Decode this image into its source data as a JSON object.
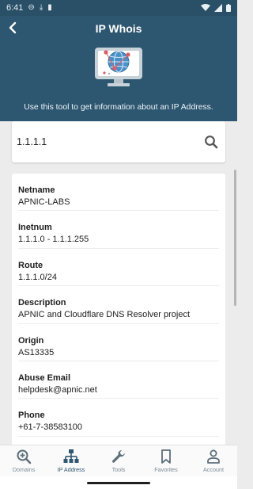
{
  "status_bar": {
    "time": "6:41"
  },
  "header": {
    "title": "IP Whois",
    "subtitle": "Use this tool to get information about an IP Address."
  },
  "search": {
    "value": "1.1.1.1",
    "placeholder": ""
  },
  "results": [
    {
      "label": "Netname",
      "value": "APNIC-LABS"
    },
    {
      "label": "Inetnum",
      "value": "1.1.1.0 - 1.1.1.255"
    },
    {
      "label": "Route",
      "value": "1.1.1.0/24"
    },
    {
      "label": "Description",
      "value": "APNIC and Cloudflare DNS Resolver project"
    },
    {
      "label": "Origin",
      "value": "AS13335"
    },
    {
      "label": "Abuse Email",
      "value": "helpdesk@apnic.net"
    },
    {
      "label": "Phone",
      "value": "+61-7-38583100"
    }
  ],
  "bottom_nav": [
    {
      "label": "Domains",
      "icon": "magnify-plus-icon"
    },
    {
      "label": "IP Address",
      "icon": "network-icon",
      "active": true
    },
    {
      "label": "Tools",
      "icon": "wrench-icon"
    },
    {
      "label": "Favorites",
      "icon": "bookmark-icon"
    },
    {
      "label": "Account",
      "icon": "person-icon"
    }
  ],
  "colors": {
    "primary": "#2d5670",
    "inactive": "#7b8b96",
    "background": "#ececec"
  }
}
